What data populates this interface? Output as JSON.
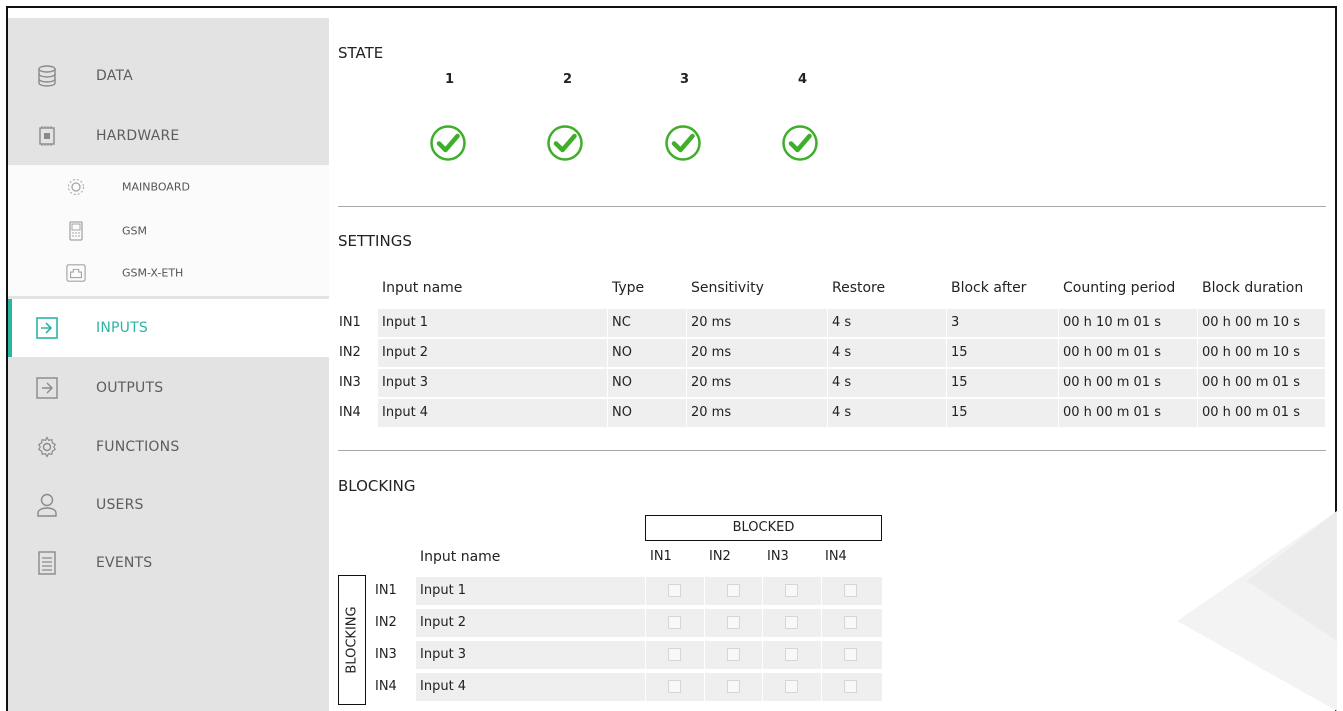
{
  "sidebar": {
    "items": [
      {
        "label": "DATA",
        "icon": "database-icon"
      },
      {
        "label": "HARDWARE",
        "icon": "chip-icon"
      },
      {
        "label": "INPUTS",
        "icon": "input-icon",
        "active": true
      },
      {
        "label": "OUTPUTS",
        "icon": "output-icon"
      },
      {
        "label": "FUNCTIONS",
        "icon": "gear-icon"
      },
      {
        "label": "USERS",
        "icon": "user-icon"
      },
      {
        "label": "EVENTS",
        "icon": "document-icon"
      }
    ],
    "sub_items": [
      {
        "label": "MAINBOARD",
        "icon": "mainboard-icon"
      },
      {
        "label": "GSM",
        "icon": "phone-icon"
      },
      {
        "label": "GSM-X-ETH",
        "icon": "ethernet-icon"
      }
    ]
  },
  "state": {
    "title": "STATE",
    "inputs": [
      {
        "number": "1",
        "status": "ok"
      },
      {
        "number": "2",
        "status": "ok"
      },
      {
        "number": "3",
        "status": "ok"
      },
      {
        "number": "4",
        "status": "ok"
      }
    ]
  },
  "settings": {
    "title": "SETTINGS",
    "columns": [
      "Input name",
      "Type",
      "Sensitivity",
      "Restore",
      "Block after",
      "Counting period",
      "Block duration"
    ],
    "rows": [
      {
        "id": "IN1",
        "name": "Input 1",
        "type": "NC",
        "sensitivity": "20 ms",
        "restore": "4 s",
        "block_after": "3",
        "counting_period": "00 h 10 m 01 s",
        "block_duration": "00 h 00 m 10 s"
      },
      {
        "id": "IN2",
        "name": "Input 2",
        "type": "NO",
        "sensitivity": "20 ms",
        "restore": "4 s",
        "block_after": "15",
        "counting_period": "00 h 00 m 01 s",
        "block_duration": "00 h 00 m 10 s"
      },
      {
        "id": "IN3",
        "name": "Input 3",
        "type": "NO",
        "sensitivity": "20 ms",
        "restore": "4 s",
        "block_after": "15",
        "counting_period": "00 h 00 m 01 s",
        "block_duration": "00 h 00 m 01 s"
      },
      {
        "id": "IN4",
        "name": "Input 4",
        "type": "NO",
        "sensitivity": "20 ms",
        "restore": "4 s",
        "block_after": "15",
        "counting_period": "00 h 00 m 01 s",
        "block_duration": "00 h 00 m 01 s"
      }
    ]
  },
  "blocking": {
    "title": "BLOCKING",
    "blocked_header": "BLOCKED",
    "side_label": "BLOCKING",
    "name_header": "Input name",
    "columns": [
      "IN1",
      "IN2",
      "IN3",
      "IN4"
    ],
    "rows": [
      {
        "id": "IN1",
        "name": "Input 1",
        "checked": [
          false,
          false,
          false,
          false
        ]
      },
      {
        "id": "IN2",
        "name": "Input 2",
        "checked": [
          false,
          false,
          false,
          false
        ]
      },
      {
        "id": "IN3",
        "name": "Input 3",
        "checked": [
          false,
          false,
          false,
          false
        ]
      },
      {
        "id": "IN4",
        "name": "Input 4",
        "checked": [
          false,
          false,
          false,
          false
        ]
      }
    ]
  },
  "colors": {
    "accent": "#2bb5a3",
    "check_green": "#3fae2a",
    "sidebar_bg": "#e3e3e3"
  }
}
